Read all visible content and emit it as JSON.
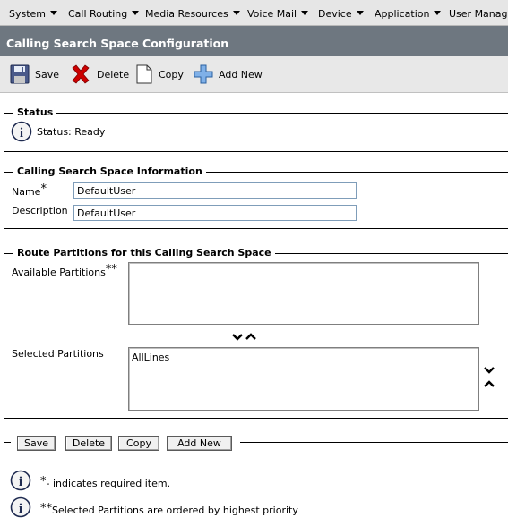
{
  "menu": {
    "items": [
      {
        "label": "System"
      },
      {
        "label": "Call Routing"
      },
      {
        "label": "Media Resources"
      },
      {
        "label": "Voice Mail"
      },
      {
        "label": "Device"
      },
      {
        "label": "Application"
      },
      {
        "label": "User Management"
      }
    ]
  },
  "page": {
    "title": "Calling Search Space Configuration"
  },
  "toolbar": {
    "save_label": "Save",
    "delete_label": "Delete",
    "copy_label": "Copy",
    "add_new_label": "Add New"
  },
  "status": {
    "legend": "Status",
    "text": "Status: Ready"
  },
  "css_info": {
    "legend": "Calling Search Space Information",
    "name_label": "Name",
    "required_marker": "*",
    "name_value": "DefaultUser",
    "description_label": "Description",
    "description_value": "DefaultUser"
  },
  "partitions": {
    "legend": "Route Partitions for this Calling Search Space",
    "available_label": "Available Partitions",
    "available_marker": "**",
    "selected_label": "Selected Partitions",
    "selected_items": [
      "AllLines"
    ]
  },
  "bottom_buttons": {
    "save": "Save",
    "delete": "Delete",
    "copy": "Copy",
    "add_new": "Add New"
  },
  "notes": {
    "required_marker": "*",
    "required_text": "- indicates required item.",
    "priority_marker": "**",
    "priority_text": "Selected Partitions are ordered by highest priority"
  },
  "colors": {
    "title_bar": "#6e7780",
    "menu_bar": "#e6e6e6",
    "toolbar": "#e8e8e8",
    "delete_red": "#cc0000",
    "add_blue": "#3f7fd0"
  }
}
